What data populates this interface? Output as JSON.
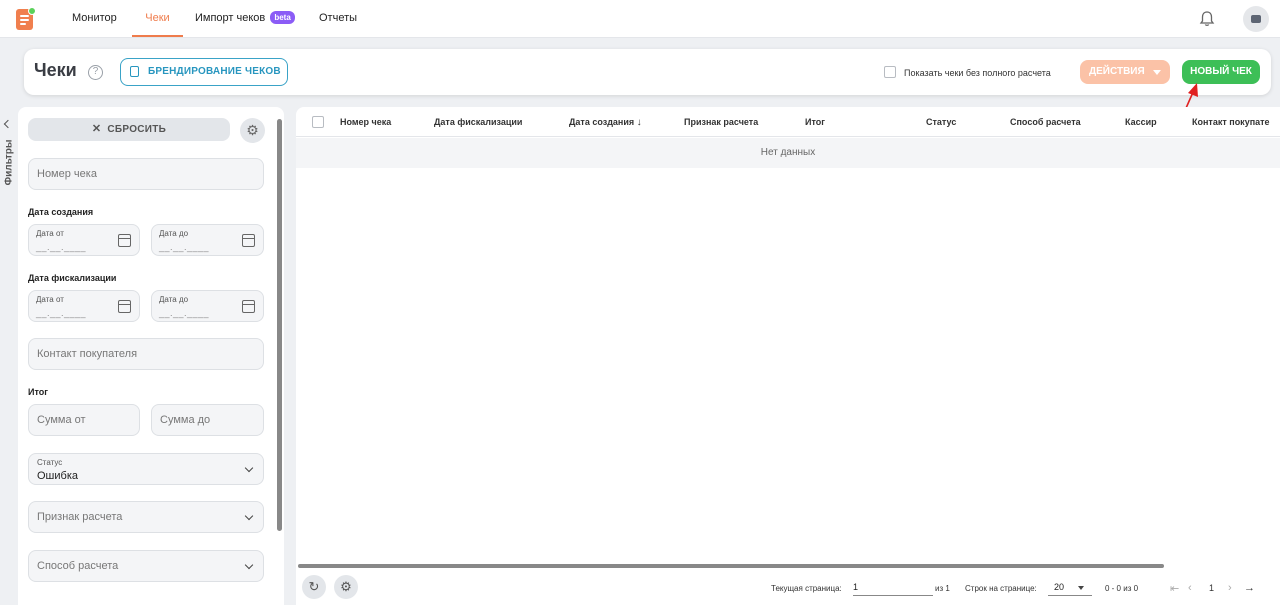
{
  "nav": {
    "items": [
      {
        "label": "Монитор"
      },
      {
        "label": "Чеки"
      },
      {
        "label": "Импорт чеков"
      },
      {
        "label": "Отчеты"
      }
    ],
    "beta_badge": "beta",
    "accent": "#ef7c4c"
  },
  "header": {
    "title": "Чеки",
    "help_icon": "?",
    "branding_button": "БРЕНДИРОВАНИЕ ЧЕКОВ",
    "show_checkbox_label": "Показать чеки без полного расчета",
    "actions_button": "ДЕЙСТВИЯ",
    "new_button": "НОВЫЙ ЧЕК",
    "new_button_color": "#3dbf57"
  },
  "sidebar": {
    "tab_label": "Фильтры",
    "reset_label": "СБРОСИТЬ",
    "receipt_number_placeholder": "Номер чека",
    "created_section": "Дата создания",
    "fiscal_section": "Дата фискализации",
    "date_from": "Дата от",
    "date_to": "Дата до",
    "date_mask": "__.__.____",
    "buyer_contact_placeholder": "Контакт покупателя",
    "total_section": "Итог",
    "sum_from_placeholder": "Сумма от",
    "sum_to_placeholder": "Сумма до",
    "status_label": "Статус",
    "status_value": "Ошибка",
    "payment_sign_placeholder": "Признак расчета",
    "payment_method_placeholder": "Способ расчета"
  },
  "table": {
    "columns": [
      "Номер чека",
      "Дата фискализации",
      "Дата создания",
      "Признак расчета",
      "Итог",
      "Статус",
      "Способ расчета",
      "Кассир",
      "Контакт покупате"
    ],
    "sort_indicator": "↓",
    "empty_text": "Нет данных"
  },
  "pagination": {
    "current_page_label": "Текущая страница:",
    "current_page_value": "1",
    "of_label": "из 1",
    "rows_per_page_label": "Строк на странице:",
    "rows_per_page_value": "20",
    "range_text": "0 - 0 из 0",
    "page_number": "1"
  }
}
